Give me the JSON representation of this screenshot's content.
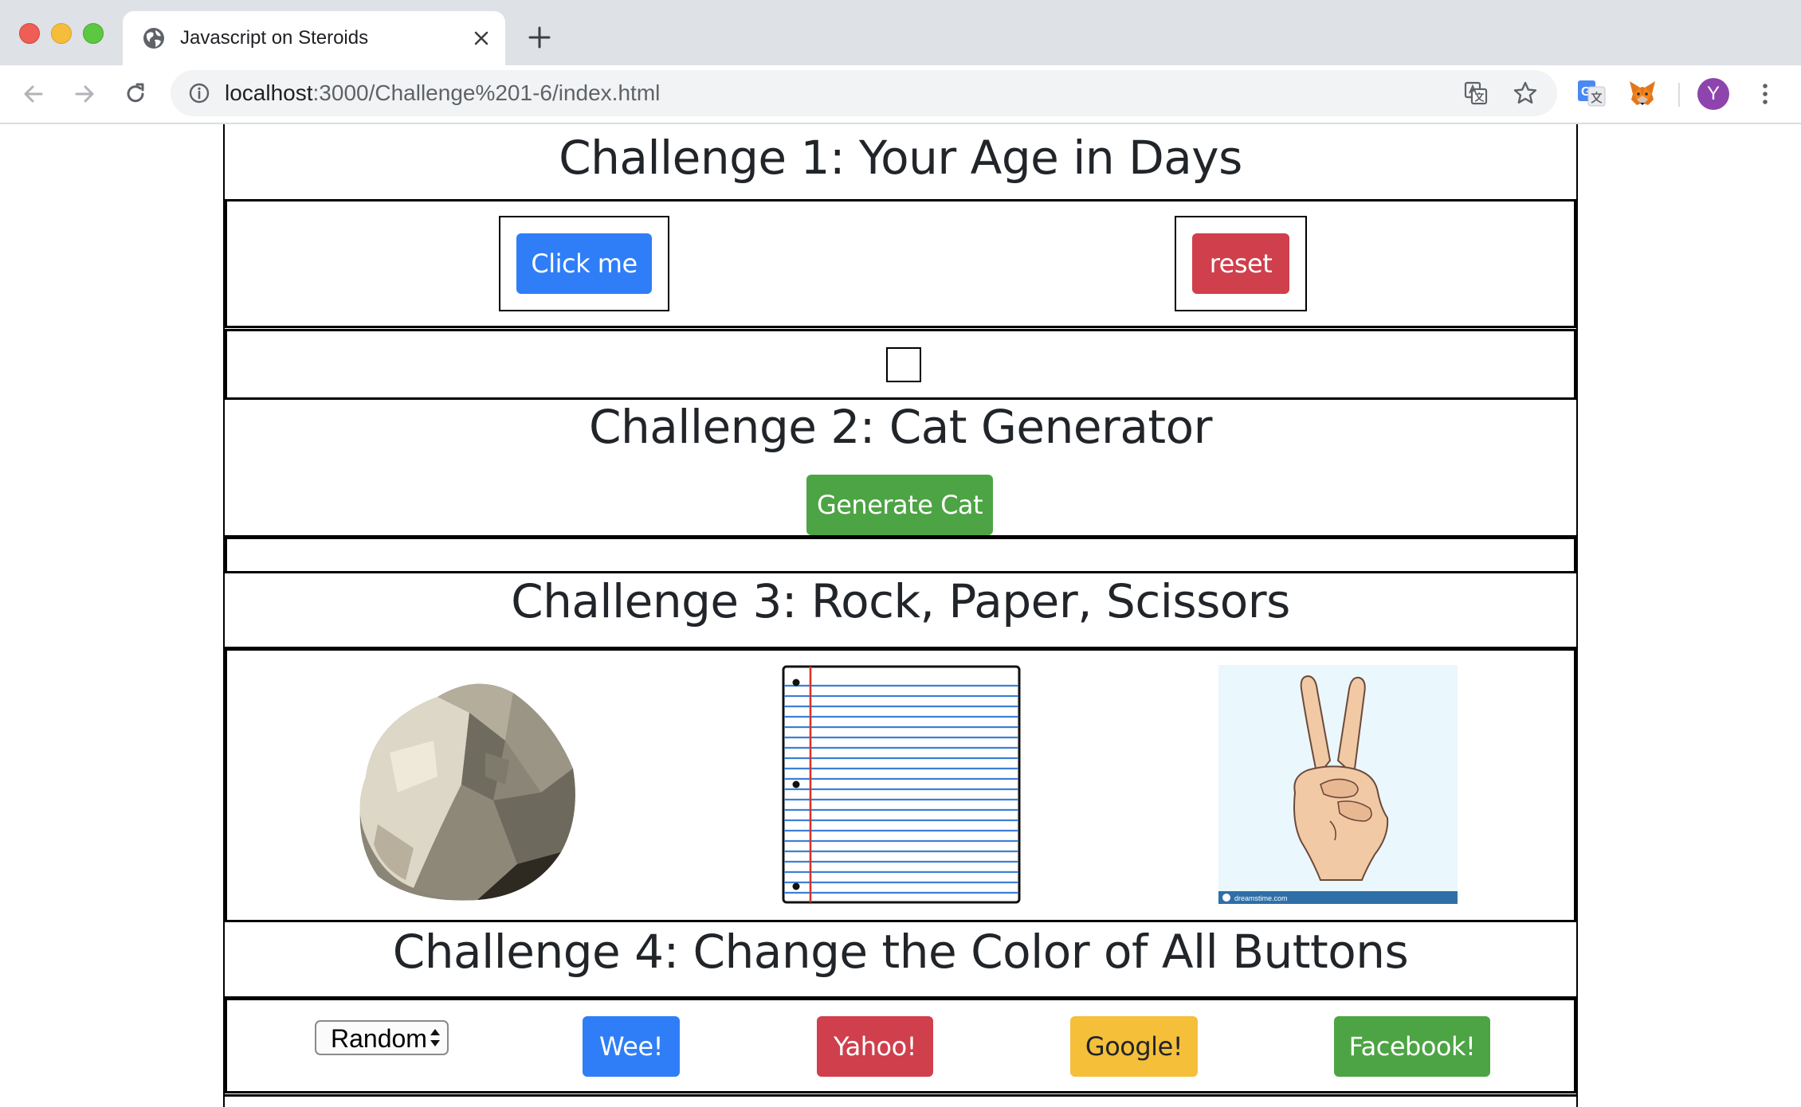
{
  "browser": {
    "tab_title": "Javascript on Steroids",
    "url_host": "localhost",
    "url_path": ":3000/Challenge%201-6/index.html",
    "profile_initial": "Y",
    "icons": [
      "globe-icon",
      "close-icon",
      "plus-icon",
      "back-icon",
      "forward-icon",
      "reload-icon",
      "info-icon",
      "translate-icon",
      "star-icon",
      "google-translate-icon",
      "metamask-fox-icon",
      "menu-dots-icon"
    ]
  },
  "challenge1": {
    "title": "Challenge 1: Your Age in Days",
    "click_label": "Click me",
    "reset_label": "reset"
  },
  "challenge2": {
    "title": "Challenge 2: Cat Generator",
    "button_label": "Generate Cat"
  },
  "challenge3": {
    "title": "Challenge 3: Rock, Paper, Scissors",
    "choices": [
      "rock",
      "paper",
      "scissors"
    ],
    "scissors_caption": "dreamstime.com"
  },
  "challenge4": {
    "title": "Challenge 4: Change the Color of All Buttons",
    "select_value": "Random",
    "buttons": [
      "Wee!",
      "Yahoo!",
      "Google!",
      "Facebook!"
    ]
  },
  "colors": {
    "primary": "#2f7ef7",
    "danger": "#cf3f4c",
    "success": "#4da444",
    "warning": "#f5bf3a"
  }
}
